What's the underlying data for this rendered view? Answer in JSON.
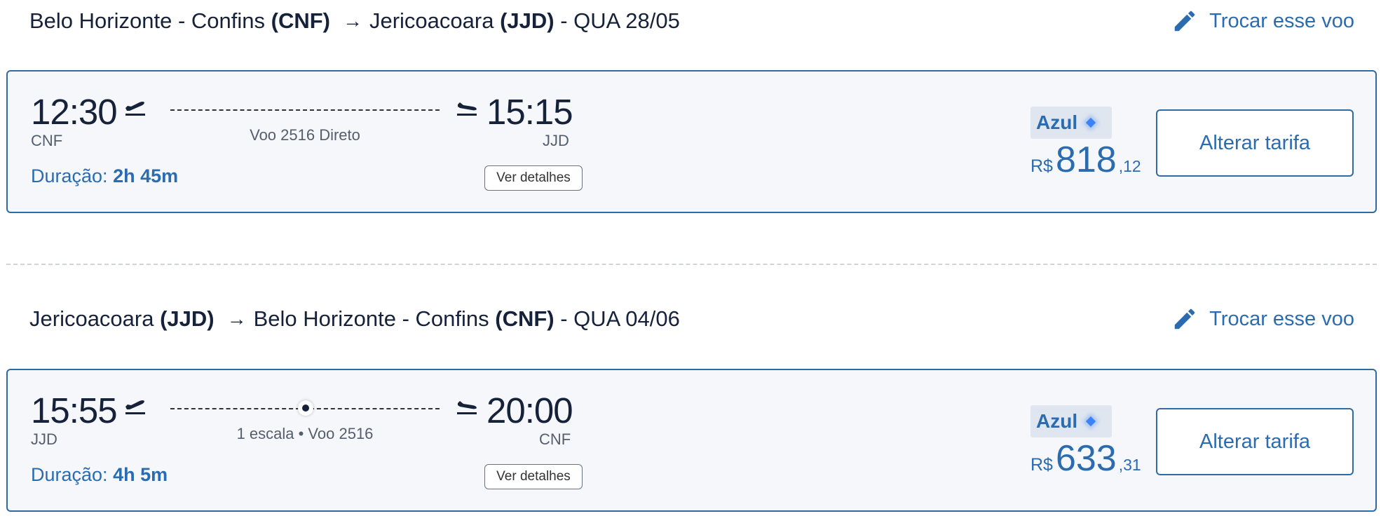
{
  "outbound": {
    "origin_city": "Belo Horizonte - Confins",
    "origin_code": "(CNF)",
    "dest_city": "Jericoacoara",
    "dest_code": "(JJD)",
    "date": "- QUA 28/05",
    "change_label": "Trocar esse voo",
    "depart_time": "12:30",
    "depart_iata": "CNF",
    "arrive_time": "15:15",
    "arrive_iata": "JJD",
    "flight_info": "Voo 2516 Direto",
    "duration_label": "Duração:",
    "duration_value": "2h 45m",
    "details_label": "Ver detalhes",
    "airline": "Azul",
    "currency": "R$",
    "price_int": "818",
    "price_cents": ",12",
    "fare_button": "Alterar tarifa"
  },
  "return": {
    "origin_city": "Jericoacoara",
    "origin_code": "(JJD)",
    "dest_city": "Belo Horizonte - Confins",
    "dest_code": "(CNF)",
    "date": "- QUA 04/06",
    "change_label": "Trocar esse voo",
    "depart_time": "15:55",
    "depart_iata": "JJD",
    "arrive_time": "20:00",
    "arrive_iata": "CNF",
    "flight_info": "1 escala • Voo 2516",
    "duration_label": "Duração:",
    "duration_value": "4h 5m",
    "details_label": "Ver detalhes",
    "airline": "Azul",
    "currency": "R$",
    "price_int": "633",
    "price_cents": ",31",
    "fare_button": "Alterar tarifa"
  },
  "icons": {
    "route_arrow": "arrow-right-icon",
    "change": "pencil-icon",
    "takeoff": "takeoff-icon",
    "landing": "landing-icon",
    "airline_badge": "diamond-icon"
  },
  "colors": {
    "accent": "#2b6cb0",
    "card_border": "#2f6aa3",
    "card_bg": "#f5f7fb",
    "text_dark": "#16213a",
    "text_muted": "#555e6c"
  }
}
